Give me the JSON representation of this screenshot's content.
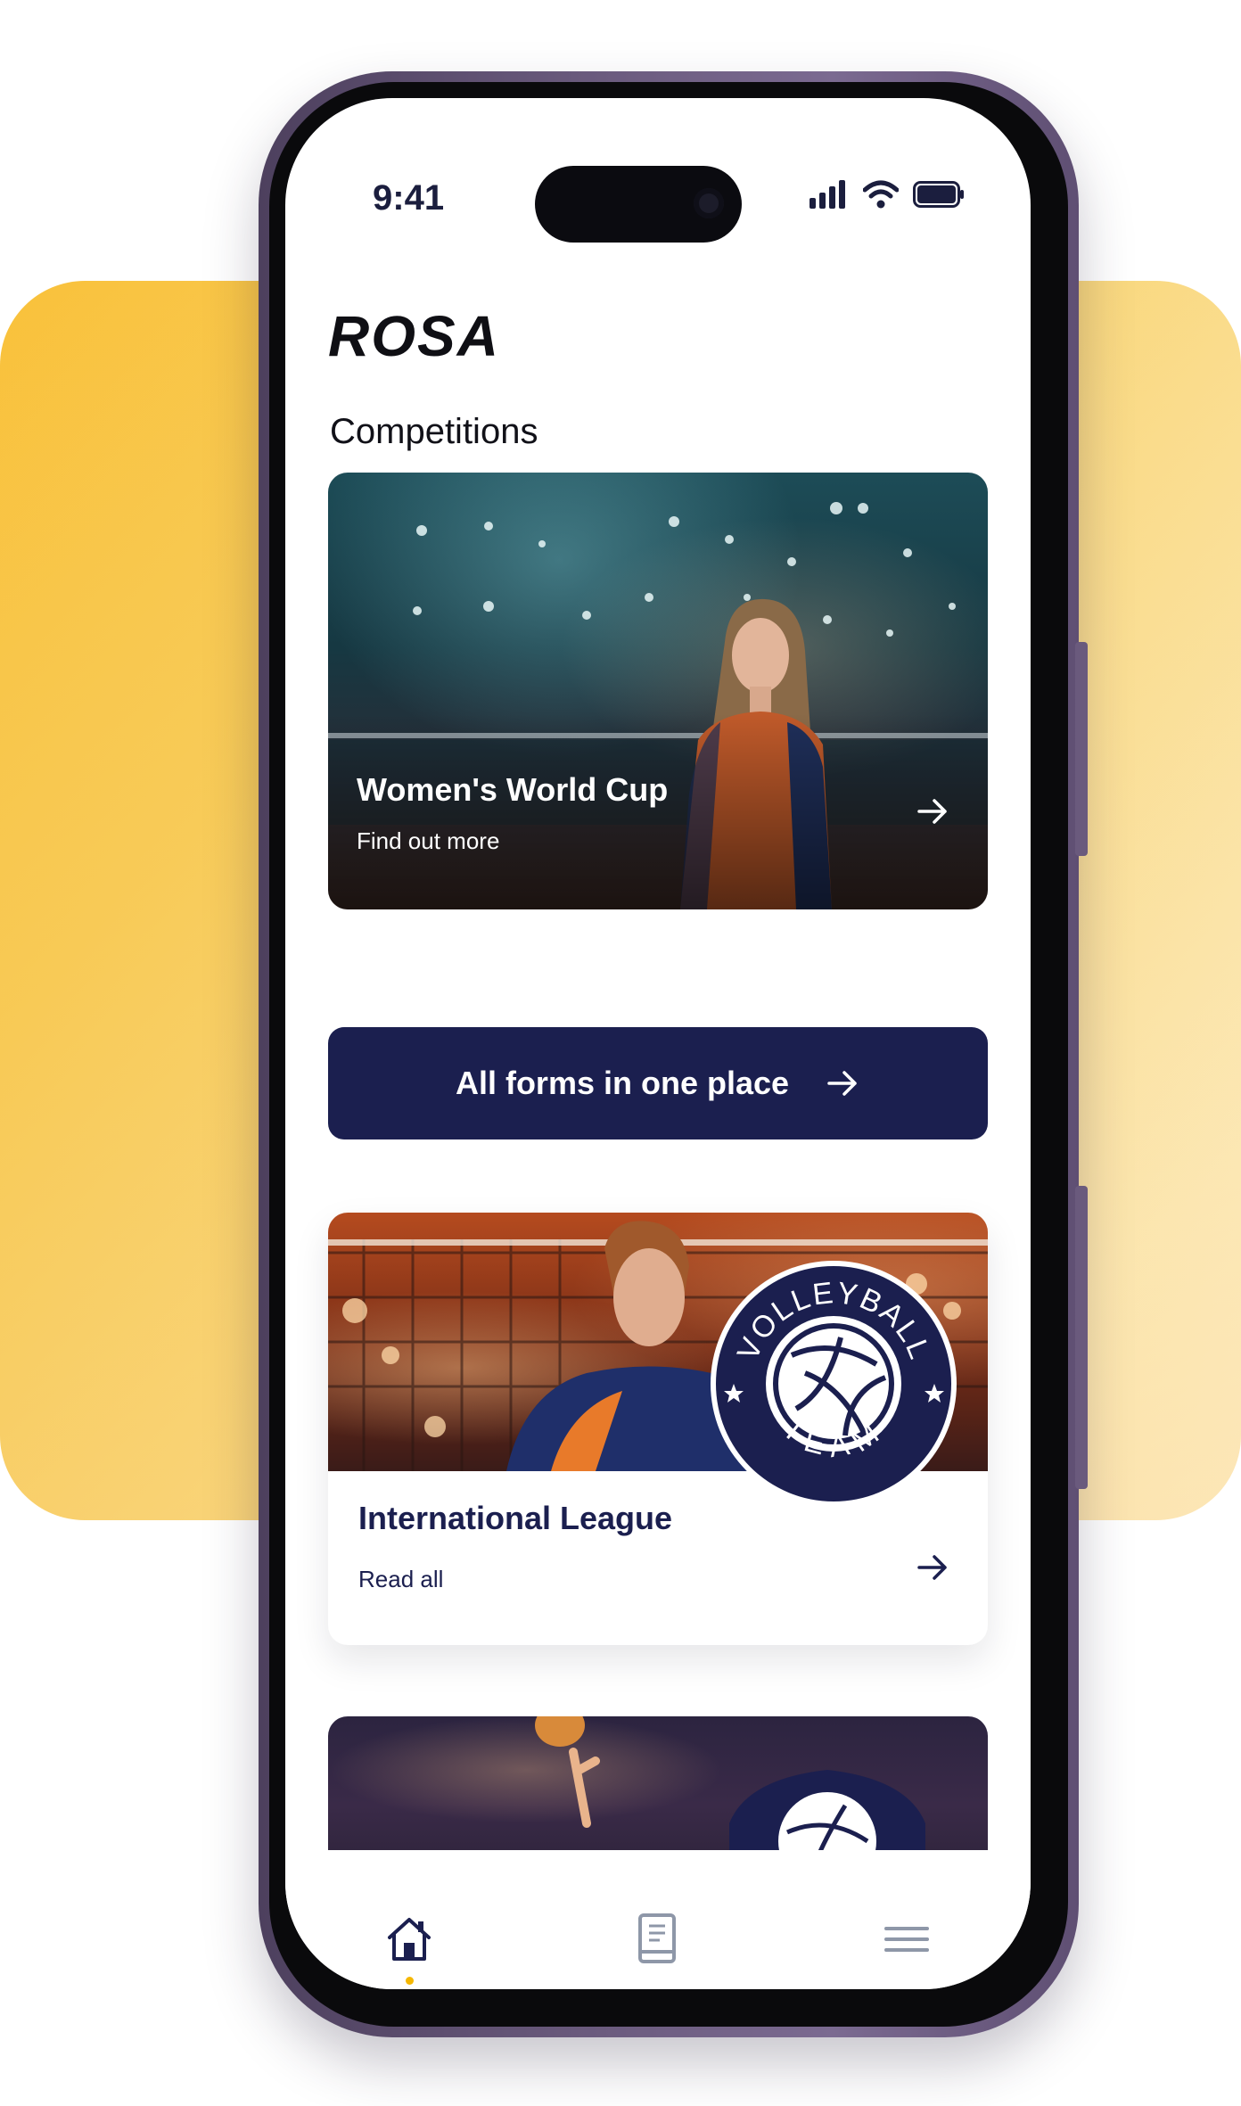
{
  "status_bar": {
    "time": "9:41",
    "icons": [
      "cellular-signal-icon",
      "wifi-icon",
      "battery-icon"
    ]
  },
  "app": {
    "brand": "ROSA"
  },
  "section": {
    "title": "Competitions"
  },
  "hero_card": {
    "title": "Women's World Cup",
    "subtitle": "Find out more",
    "arrow_icon": "arrow-right-icon"
  },
  "cta": {
    "label": "All forms in one place",
    "arrow_icon": "arrow-right-icon"
  },
  "league_card": {
    "title": "International League",
    "subtitle": "Read all",
    "arrow_icon": "arrow-right-icon",
    "badge": {
      "top_text": "VOLLEYBALL",
      "bottom_text": "TEAM"
    }
  },
  "tab_bar": {
    "tabs": [
      {
        "name": "home",
        "icon": "home-icon",
        "active": true
      },
      {
        "name": "book",
        "icon": "book-icon",
        "active": false
      },
      {
        "name": "menu",
        "icon": "hamburger-menu-icon",
        "active": false
      }
    ]
  },
  "colors": {
    "navy": "#1b1f4f",
    "accent_yellow": "#f5b700",
    "background_yellow": "#f9c13a",
    "phone_frame": "#6a5a7d"
  }
}
